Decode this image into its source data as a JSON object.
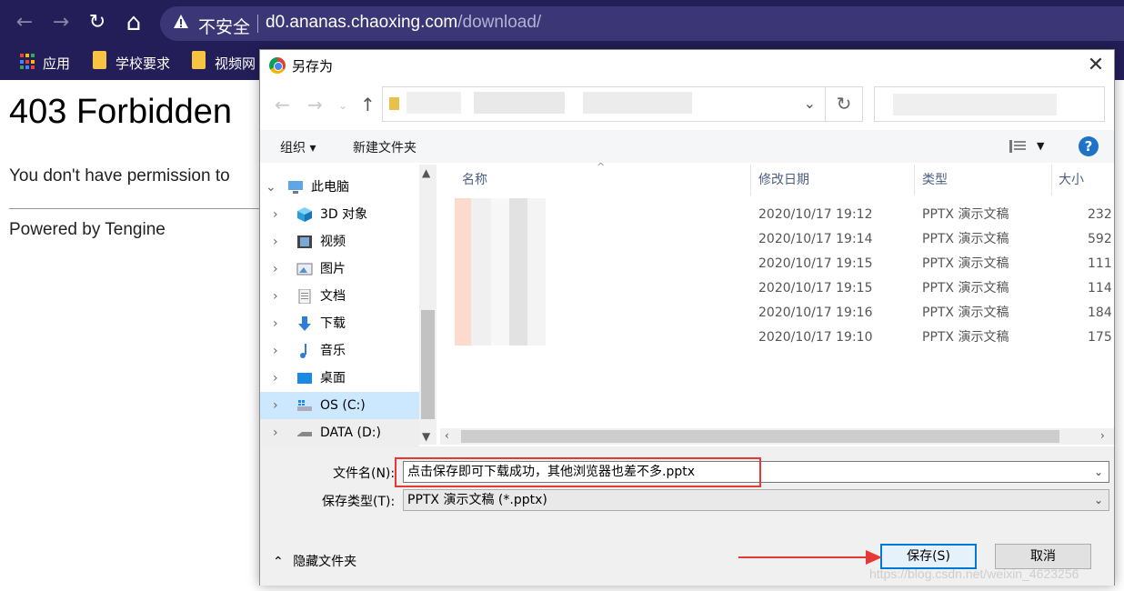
{
  "browser": {
    "back": "←",
    "forward": "→",
    "reload": "↻",
    "home": "⌂",
    "security_label": "不安全",
    "url_host": "d0.ananas.chaoxing.com",
    "url_path": "/download/",
    "bookmarks": [
      {
        "label": "应用"
      },
      {
        "label": "学校要求"
      },
      {
        "label": "视频网"
      }
    ]
  },
  "page": {
    "heading": "403 Forbidden",
    "message": "You don't have permission to",
    "footer": "Powered by Tengine"
  },
  "dialog": {
    "title": "另存为",
    "close": "✕",
    "toolbar": {
      "organize": "组织 ▾",
      "new_folder": "新建文件夹",
      "help": "?"
    },
    "nav_items": [
      {
        "label": "此电脑",
        "icon": "pc-icon"
      },
      {
        "label": "3D 对象",
        "icon": "cube-icon"
      },
      {
        "label": "视频",
        "icon": "video-icon"
      },
      {
        "label": "图片",
        "icon": "picture-icon"
      },
      {
        "label": "文档",
        "icon": "document-icon"
      },
      {
        "label": "下载",
        "icon": "download-icon"
      },
      {
        "label": "音乐",
        "icon": "music-icon"
      },
      {
        "label": "桌面",
        "icon": "desktop-icon"
      },
      {
        "label": "OS (C:)",
        "icon": "drive-icon"
      },
      {
        "label": "DATA (D:)",
        "icon": "drive-icon"
      }
    ],
    "columns": {
      "name": "名称",
      "date": "修改日期",
      "type": "类型",
      "size": "大小"
    },
    "files": [
      {
        "date": "2020/10/17 19:12",
        "type": "PPTX 演示文稿",
        "size": "232"
      },
      {
        "date": "2020/10/17 19:14",
        "type": "PPTX 演示文稿",
        "size": "592"
      },
      {
        "date": "2020/10/17 19:15",
        "type": "PPTX 演示文稿",
        "size": "111"
      },
      {
        "date": "2020/10/17 19:15",
        "type": "PPTX 演示文稿",
        "size": "114"
      },
      {
        "date": "2020/10/17 19:16",
        "type": "PPTX 演示文稿",
        "size": "184"
      },
      {
        "date": "2020/10/17 19:10",
        "type": "PPTX 演示文稿",
        "size": "175"
      }
    ],
    "filename_label": "文件名(N):",
    "filename_value": "点击保存即可下载成功，其他浏览器也差不多.pptx",
    "filetype_label": "保存类型(T):",
    "filetype_value": "PPTX 演示文稿 (*.pptx)",
    "hide_folders": "隐藏文件夹",
    "save_button": "保存(S)",
    "cancel_button": "取消"
  },
  "annotation": {
    "highlight_color": "#e53935"
  },
  "watermark": "https://blog.csdn.net/weixin_4623256"
}
